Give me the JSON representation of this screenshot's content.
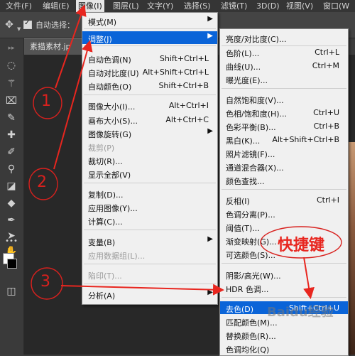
{
  "menubar": {
    "items": [
      "文件(F)",
      "编辑(E)",
      "图像(I)",
      "图层(L)",
      "文字(Y)",
      "选择(S)",
      "滤镜(T)",
      "3D(D)",
      "视图(V)",
      "窗口(W"
    ]
  },
  "options_bar": {
    "auto_select_label": "自动选择："
  },
  "document_tab": {
    "title": "素描素材.jp"
  },
  "image_menu": {
    "items": [
      {
        "label": "模式(M)",
        "shortcut": "",
        "submenu": true
      },
      {
        "label": "调整(J)",
        "shortcut": "",
        "submenu": true,
        "highlighted": true
      },
      {
        "label": "自动色调(N)",
        "shortcut": "Shift+Ctrl+L"
      },
      {
        "label": "自动对比度(U)",
        "shortcut": "Alt+Shift+Ctrl+L"
      },
      {
        "label": "自动颜色(O)",
        "shortcut": "Shift+Ctrl+B"
      },
      {
        "label": "图像大小(I)...",
        "shortcut": "Alt+Ctrl+I"
      },
      {
        "label": "画布大小(S)...",
        "shortcut": "Alt+Ctrl+C"
      },
      {
        "label": "图像旋转(G)",
        "shortcut": "",
        "submenu": true
      },
      {
        "label": "裁剪(P)",
        "shortcut": "",
        "disabled": true
      },
      {
        "label": "裁切(R)...",
        "shortcut": ""
      },
      {
        "label": "显示全部(V)",
        "shortcut": ""
      },
      {
        "label": "复制(D)...",
        "shortcut": ""
      },
      {
        "label": "应用图像(Y)...",
        "shortcut": ""
      },
      {
        "label": "计算(C)...",
        "shortcut": ""
      },
      {
        "label": "变量(B)",
        "shortcut": "",
        "submenu": true
      },
      {
        "label": "应用数据组(L)...",
        "shortcut": "",
        "disabled": true
      },
      {
        "label": "陷印(T)...",
        "shortcut": "",
        "disabled": true
      },
      {
        "label": "分析(A)",
        "shortcut": "",
        "submenu": true
      }
    ]
  },
  "adjust_menu": {
    "items": [
      {
        "label": "亮度/对比度(C)...",
        "shortcut": ""
      },
      {
        "label": "色阶(L)...",
        "shortcut": "Ctrl+L"
      },
      {
        "label": "曲线(U)...",
        "shortcut": "Ctrl+M"
      },
      {
        "label": "曝光度(E)...",
        "shortcut": ""
      },
      {
        "label": "自然饱和度(V)...",
        "shortcut": ""
      },
      {
        "label": "色相/饱和度(H)...",
        "shortcut": "Ctrl+U"
      },
      {
        "label": "色彩平衡(B)...",
        "shortcut": "Ctrl+B"
      },
      {
        "label": "黑白(K)...",
        "shortcut": "Alt+Shift+Ctrl+B"
      },
      {
        "label": "照片滤镜(F)...",
        "shortcut": ""
      },
      {
        "label": "通道混合器(X)...",
        "shortcut": ""
      },
      {
        "label": "颜色查找...",
        "shortcut": ""
      },
      {
        "label": "反相(I)",
        "shortcut": "Ctrl+I"
      },
      {
        "label": "色调分离(P)...",
        "shortcut": ""
      },
      {
        "label": "阈值(T)...",
        "shortcut": ""
      },
      {
        "label": "渐变映射(G)...",
        "shortcut": ""
      },
      {
        "label": "可选颜色(S)...",
        "shortcut": ""
      },
      {
        "label": "阴影/高光(W)...",
        "shortcut": ""
      },
      {
        "label": "HDR 色调...",
        "shortcut": ""
      },
      {
        "label": "去色(D)",
        "shortcut": "Shift+Ctrl+U",
        "highlighted": true
      },
      {
        "label": "匹配颜色(M)...",
        "shortcut": ""
      },
      {
        "label": "替换颜色(R)...",
        "shortcut": ""
      },
      {
        "label": "色调均化(Q)",
        "shortcut": ""
      }
    ]
  },
  "annotations": {
    "numbers": [
      "1",
      "2",
      "3"
    ],
    "callout": "快捷键",
    "color": "#e8261f"
  },
  "watermark": "Baidu经验"
}
